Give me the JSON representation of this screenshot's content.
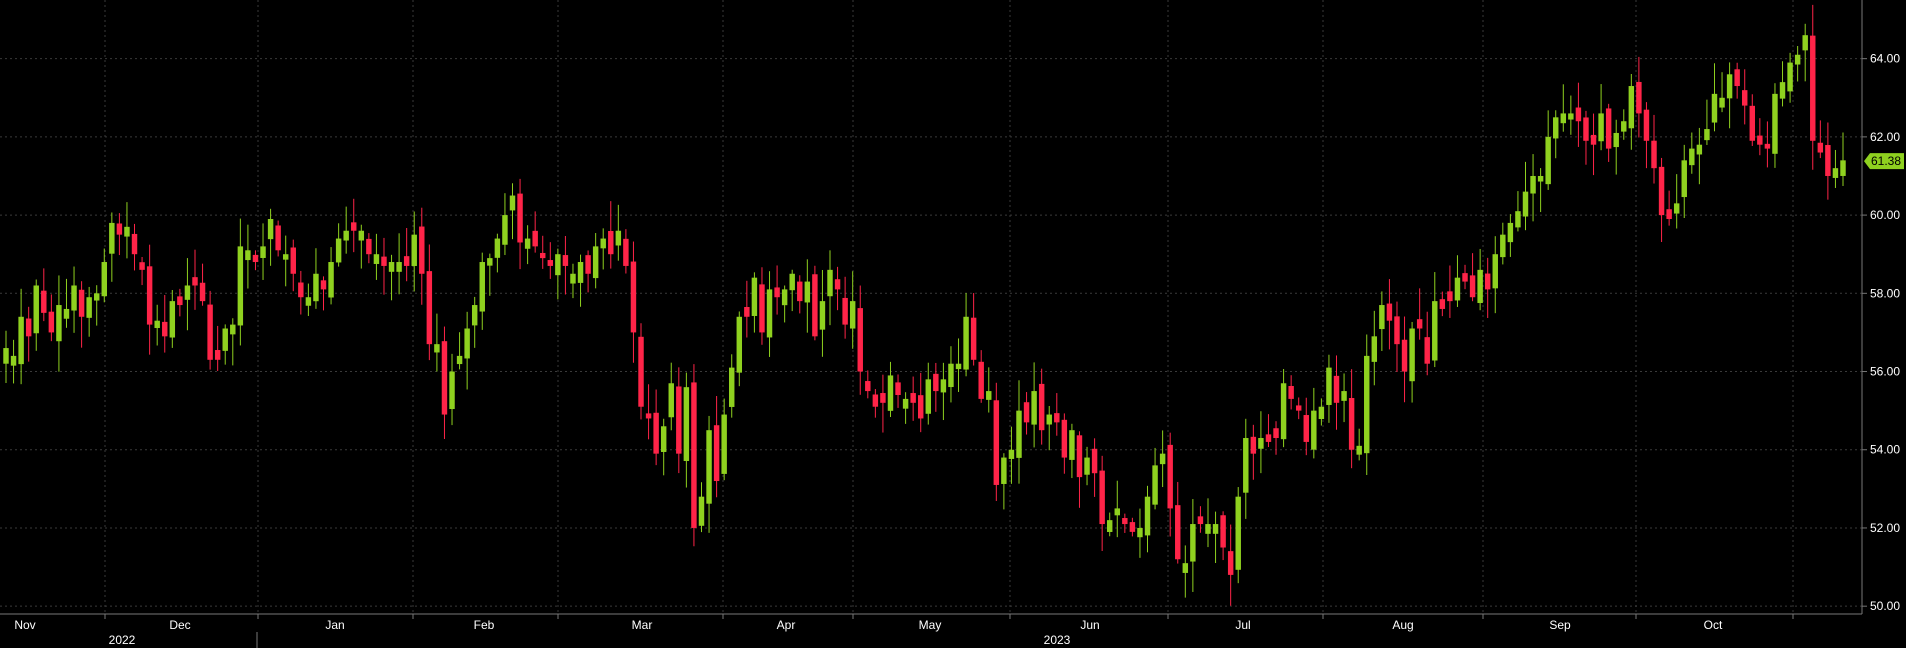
{
  "chart_data": {
    "type": "candlestick",
    "ylim": [
      49.8,
      65.5
    ],
    "y_ticks": [
      "50.00",
      "52.00",
      "54.00",
      "56.00",
      "58.00",
      "60.00",
      "62.00",
      "64.00"
    ],
    "y_tick_values": [
      50,
      52,
      54,
      56,
      58,
      60,
      62,
      64
    ],
    "x_month_labels": [
      "Nov",
      "Dec",
      "Jan",
      "Feb",
      "Mar",
      "Apr",
      "May",
      "Jun",
      "Jul",
      "Aug",
      "Sep",
      "Oct"
    ],
    "year_labels": [
      "2022",
      "2023"
    ],
    "last_price": "61.38",
    "grid": true,
    "colors": {
      "up": "#8fd11f",
      "down": "#ff2448",
      "grid": "#3a3a3a",
      "axis": "#777777",
      "last_bg": "#8fd11f"
    },
    "close": [
      56.6,
      56.4,
      57.4,
      56.9,
      58.2,
      57.5,
      57.0,
      57.7,
      57.6,
      58.2,
      57.4,
      57.9,
      58.0,
      58.8,
      59.8,
      59.5,
      59.7,
      59.0,
      58.6,
      57.2,
      57.3,
      56.9,
      57.8,
      57.7,
      58.2,
      58.2,
      57.8,
      56.3,
      56.3,
      57.1,
      57.2,
      59.2,
      59.1,
      58.8,
      59.2,
      59.9,
      59.1,
      59.0,
      58.5,
      57.9,
      57.9,
      58.5,
      58.1,
      58.8,
      59.4,
      59.6,
      59.6,
      59.6,
      59.0,
      59.0,
      58.7,
      58.8,
      58.8,
      58.7,
      59.5,
      58.5,
      56.7,
      56.7,
      54.9,
      56.0,
      56.4,
      57.1,
      57.7,
      58.8,
      58.9,
      59.4,
      60.0,
      60.5,
      59.3,
      59.4,
      59.2,
      58.9,
      58.7,
      59.0,
      58.7,
      58.5,
      58.8,
      58.5,
      59.2,
      59.4,
      59.0,
      59.6,
      58.7,
      57.0,
      55.1,
      54.8,
      53.9,
      54.6,
      55.7,
      53.9,
      55.6,
      52.0,
      52.8,
      54.5,
      53.2,
      54.9,
      56.1,
      57.4,
      57.4,
      58.4,
      57.0,
      58.1,
      57.9,
      58.1,
      58.5,
      57.8,
      58.3,
      56.9,
      57.8,
      58.6,
      58.1,
      57.2,
      57.8,
      56.0,
      55.5,
      55.1,
      55.2,
      55.9,
      55.4,
      55.3,
      55.2,
      54.8,
      55.8,
      55.5,
      55.8,
      56.2,
      56.2,
      57.4,
      56.3,
      55.3,
      55.5,
      53.1,
      53.8,
      54.0,
      55.0,
      54.7,
      55.5,
      54.5,
      54.9,
      54.7,
      53.8,
      54.5,
      53.3,
      53.8,
      53.4,
      52.1,
      52.2,
      52.5,
      52.1,
      51.9,
      52.0,
      52.8,
      53.6,
      53.9,
      52.5,
      51.2,
      51.1,
      52.1,
      52.1,
      52.1,
      52.1,
      51.5,
      50.8,
      52.8,
      54.3,
      53.9,
      54.3,
      54.2,
      54.3,
      55.7,
      55.3,
      55.0,
      54.2,
      55.0,
      55.1,
      56.1,
      55.2,
      55.5,
      54.0,
      54.1,
      56.4,
      56.9,
      57.7,
      57.3,
      56.7,
      56.0,
      57.1,
      57.1,
      56.2,
      57.8,
      57.6,
      57.8,
      58.4,
      58.3,
      57.9,
      58.6,
      58.1,
      59.0,
      59.5,
      59.8,
      60.1,
      60.6,
      61.0,
      61.0,
      62.0,
      62.5,
      62.6,
      62.6,
      62.4,
      61.9,
      61.8,
      62.6,
      61.7,
      62.1,
      62.4,
      63.3,
      62.6,
      61.9,
      61.2,
      60.0,
      59.9,
      60.3,
      61.4,
      61.7,
      61.8,
      62.2,
      63.1,
      63.0,
      63.6,
      63.3,
      62.8,
      61.9,
      61.8,
      61.7,
      63.1,
      63.4,
      63.9,
      64.1,
      64.6,
      61.9,
      61.6,
      61.0,
      61.2,
      61.4
    ]
  }
}
